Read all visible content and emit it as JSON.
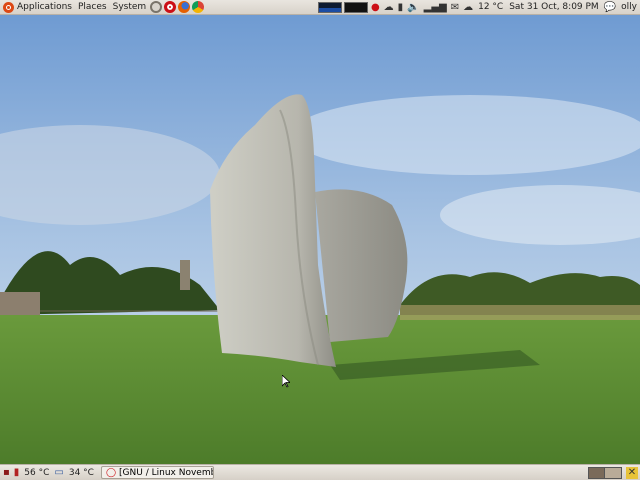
{
  "top_panel": {
    "menus": [
      "Applications",
      "Places",
      "System"
    ],
    "weather": "12 °C",
    "clock": "Sat 31 Oct,  8:09 PM",
    "user": "olly"
  },
  "bottom_panel": {
    "cpu_temp": "56 °C",
    "hdd_temp": "34 °C",
    "task_title": "[GNU / Linux Novembe..."
  },
  "colors": {
    "panel": "#dcd7cf",
    "firefox": "#e66000",
    "opera": "#cc0f16",
    "sky": "#7ea8d8",
    "grass": "#5f8f36"
  }
}
